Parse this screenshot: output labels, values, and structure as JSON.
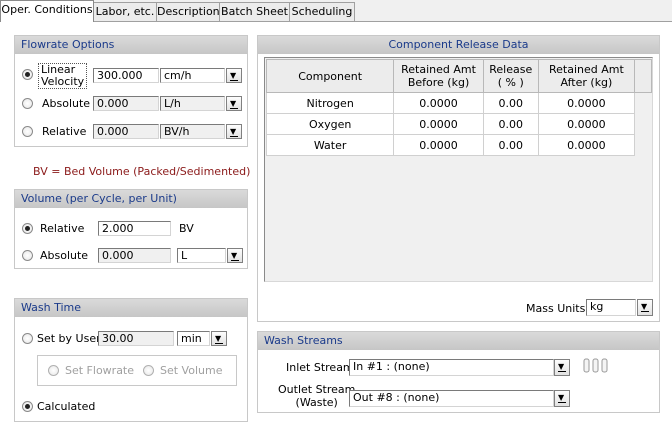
{
  "tabs": [
    "Oper. Conditions",
    "Labor, etc.",
    "Description",
    "Batch Sheet",
    "Scheduling"
  ],
  "flowrate": {
    "title": "Flowrate Options",
    "rows": [
      {
        "label_line1": "Linear",
        "label_line2": "Velocity",
        "value": "300.000",
        "unit": "cm/h",
        "selected": true
      },
      {
        "label": "Absolute",
        "value": "0.000",
        "unit": "L/h",
        "selected": false
      },
      {
        "label": "Relative",
        "value": "0.000",
        "unit": "BV/h",
        "selected": false
      }
    ]
  },
  "bv_note": "BV = Bed Volume (Packed/Sedimented)",
  "volume": {
    "title": "Volume (per Cycle, per Unit)",
    "relative": {
      "label": "Relative",
      "value": "2.000",
      "unit": "BV"
    },
    "absolute": {
      "label": "Absolute",
      "value": "0.000",
      "unit": "L"
    }
  },
  "wash_time": {
    "title": "Wash Time",
    "set_by_user": {
      "label": "Set by User",
      "value": "30.00",
      "unit": "min"
    },
    "sub_options": [
      "Set Flowrate",
      "Set Volume"
    ],
    "calculated": {
      "label": "Calculated"
    }
  },
  "release": {
    "title": "Component Release Data",
    "headers": [
      {
        "l1": "Component",
        "l2": ""
      },
      {
        "l1": "Retained Amt",
        "l2": "Before (kg)"
      },
      {
        "l1": "Release",
        "l2": "( % )"
      },
      {
        "l1": "Retained Amt",
        "l2": "After (kg)"
      }
    ],
    "rows": [
      [
        "Nitrogen",
        "0.0000",
        "0.00",
        "0.0000"
      ],
      [
        "Oxygen",
        "0.0000",
        "0.00",
        "0.0000"
      ],
      [
        "Water",
        "0.0000",
        "0.00",
        "0.0000"
      ]
    ],
    "mass_units_label": "Mass Units",
    "mass_units_value": "kg"
  },
  "wash_streams": {
    "title": "Wash Streams",
    "inlet_label": "Inlet Stream",
    "inlet_value": "In #1 : (none)",
    "outlet_label_line1": "Outlet Stream",
    "outlet_label_line2": "(Waste)",
    "outlet_value": "Out #8 : (none)"
  },
  "colors": {
    "group_title_text": "#1a3a8a",
    "note_text": "#8b1a1a"
  }
}
